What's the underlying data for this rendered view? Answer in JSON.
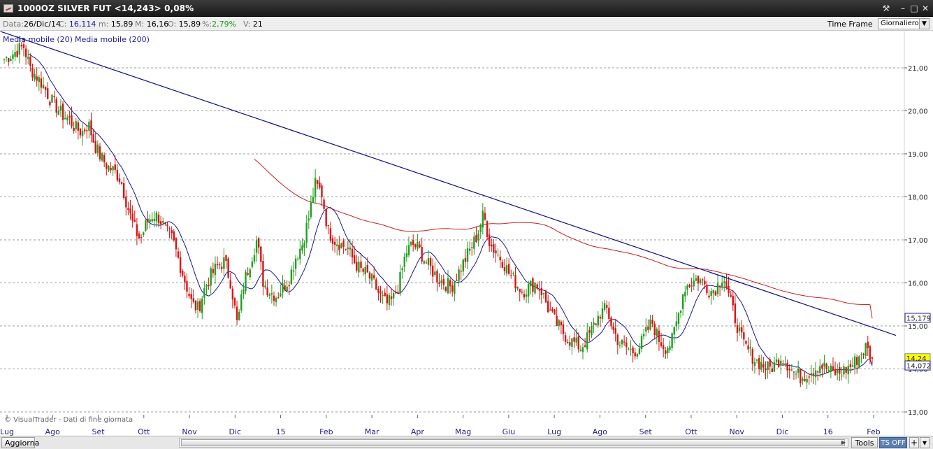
{
  "window": {
    "title": "1000OZ SILVER FUT <14,243> 0,08%"
  },
  "infobar": {
    "data_label": "Data:",
    "data_value": "26/Dic/14",
    "close_label": "C:",
    "close_value": "16,114",
    "min_label": "m:",
    "min_value": "15,89",
    "max_label": "M:",
    "max_value": "16,16",
    "open_label": "O:",
    "open_value": "15,89",
    "pct_label": "%:",
    "pct_value": "2,79%",
    "vol_label": "V:",
    "vol_value": "21",
    "timeframe_label": "Time Frame",
    "timeframe_value": "Giornaliero"
  },
  "bottombar": {
    "update_label": "Aggiorna",
    "tools_label": "Tools",
    "ts_label": "TS OFF"
  },
  "colors": {
    "up": "#1ea01e",
    "down": "#dd1111",
    "ma20": "#16168c",
    "ma200": "#c81e1e",
    "trendline": "#0a0a8c",
    "grid": "#9a9a9a",
    "price_tag": "#ffff00"
  },
  "chart_data": {
    "type": "candlestick",
    "title": "1000OZ SILVER FUT",
    "legend": [
      "Media mobile (20)",
      "Media mobile (200)"
    ],
    "credit": "© VisualTrader - Dati di fine giornata",
    "y_ticks": [
      "21,00",
      "20,00",
      "19,00",
      "18,00",
      "17,00",
      "16,00",
      "15,00",
      "14,00",
      "13,00"
    ],
    "y_tick_values": [
      21,
      20,
      19,
      18,
      17,
      16,
      15,
      14,
      13
    ],
    "ylim": [
      12.8,
      21.8
    ],
    "x_labels": [
      "Lug",
      "Ago",
      "Set",
      "Ott",
      "Nov",
      "Dic",
      "15",
      "Feb",
      "Mar",
      "Apr",
      "Mag",
      "Giu",
      "Lug",
      "Ago",
      "Set",
      "Ott",
      "Nov",
      "Dic",
      "16",
      "Feb"
    ],
    "last_price_label": "14,24",
    "last_price": 14.24,
    "ma200_last_label": "15,179",
    "ma200_last": 15.179,
    "ma20_last_label": "14,072",
    "ma20_last": 14.072,
    "close_series": [
      21.2,
      21.3,
      21.4,
      21.5,
      21.0,
      20.8,
      20.6,
      20.3,
      20.1,
      19.9,
      19.8,
      19.6,
      19.5,
      19.7,
      19.2,
      18.9,
      18.7,
      18.6,
      18.4,
      17.8,
      17.3,
      17.0,
      17.4,
      17.6,
      17.5,
      17.2,
      17.0,
      16.5,
      16.0,
      15.5,
      15.4,
      15.9,
      16.2,
      16.4,
      16.5,
      16.0,
      15.0,
      16.0,
      16.5,
      17.0,
      16.0,
      15.8,
      15.7,
      15.9,
      16.1,
      16.6,
      16.9,
      17.5,
      18.3,
      18.1,
      17.2,
      17.0,
      16.9,
      16.8,
      16.5,
      16.3,
      16.2,
      16.0,
      15.7,
      15.5,
      15.6,
      16.0,
      16.7,
      16.9,
      16.8,
      16.5,
      16.3,
      16.1,
      16.0,
      15.9,
      16.2,
      16.5,
      16.8,
      17.1,
      17.6,
      16.9,
      16.7,
      16.5,
      16.2,
      16.0,
      15.8,
      15.9,
      16.0,
      15.8,
      15.4,
      15.1,
      14.9,
      14.7,
      14.6,
      14.5,
      14.7,
      15.0,
      15.3,
      15.4,
      14.9,
      14.6,
      14.5,
      14.4,
      14.5,
      14.8,
      15.1,
      14.7,
      14.5,
      14.6,
      15.2,
      15.9,
      16.0,
      16.1,
      16.0,
      15.8,
      15.9,
      16.2,
      15.6,
      15.1,
      14.6,
      14.4,
      14.2,
      14.1,
      14.0,
      14.1,
      14.3,
      14.1,
      13.9,
      13.8,
      13.9,
      14.0,
      14.1,
      14.0,
      13.9,
      13.9,
      14.0,
      14.1,
      14.3,
      14.5,
      14.24
    ]
  }
}
